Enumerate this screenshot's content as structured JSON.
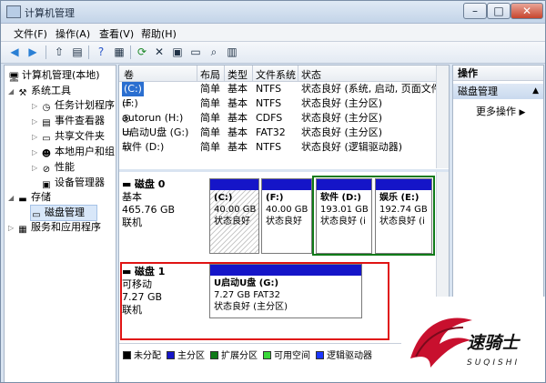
{
  "window": {
    "title": "计算机管理",
    "minimize": "–",
    "maximize": "□",
    "close": "✕"
  },
  "menu": [
    "文件(F)",
    "操作(A)",
    "查看(V)",
    "帮助(H)"
  ],
  "tree": {
    "root": "计算机管理(本地)",
    "system_tools": "系统工具",
    "task_scheduler": "任务计划程序",
    "event_viewer": "事件查看器",
    "shared_folders": "共享文件夹",
    "local_users": "本地用户和组",
    "performance": "性能",
    "device_manager": "设备管理器",
    "storage": "存储",
    "disk_management": "磁盘管理",
    "services_apps": "服务和应用程序"
  },
  "volume_table": {
    "headers": [
      "卷",
      "布局",
      "类型",
      "文件系统",
      "状态"
    ],
    "rows": [
      {
        "name": "(C:)",
        "layout": "简单",
        "type": "基本",
        "fs": "NTFS",
        "status": "状态良好 (系统, 启动, 页面文件, 活"
      },
      {
        "name": "(F:)",
        "layout": "简单",
        "type": "基本",
        "fs": "NTFS",
        "status": "状态良好 (主分区)"
      },
      {
        "name": "autorun (H:)",
        "layout": "简单",
        "type": "基本",
        "fs": "CDFS",
        "status": "状态良好 (主分区)"
      },
      {
        "name": "U启动U盘 (G:)",
        "layout": "简单",
        "type": "基本",
        "fs": "FAT32",
        "status": "状态良好 (主分区)"
      },
      {
        "name": "软件 (D:)",
        "layout": "简单",
        "type": "基本",
        "fs": "NTFS",
        "status": "状态良好 (逻辑驱动器)"
      }
    ]
  },
  "disk0": {
    "name": "磁盘 0",
    "type": "基本",
    "size": "465.76 GB",
    "state": "联机",
    "partitions": [
      {
        "name": "(C:)",
        "size": "40.00 GB",
        "status": "状态良好"
      },
      {
        "name": "(F:)",
        "size": "40.00 GB",
        "status": "状态良好"
      },
      {
        "name": "软件 (D:)",
        "size": "193.01 GB",
        "status": "状态良好 (i"
      },
      {
        "name": "娱乐 (E:)",
        "size": "192.74 GB",
        "status": "状态良好 (i"
      }
    ]
  },
  "disk1": {
    "name": "磁盘 1",
    "type": "可移动",
    "size": "7.27 GB",
    "state": "联机",
    "partition": {
      "name": "U启动U盘 (G:)",
      "size": "7.27 GB FAT32",
      "status": "状态良好 (主分区)"
    }
  },
  "legend": [
    {
      "label": "未分配",
      "color": "#000000"
    },
    {
      "label": "主分区",
      "color": "#1515c8"
    },
    {
      "label": "扩展分区",
      "color": "#0f7a18"
    },
    {
      "label": "可用空间",
      "color": "#3ad83a"
    },
    {
      "label": "逻辑驱动器",
      "color": "#1b36ff"
    }
  ],
  "actions": {
    "header": "操作",
    "section": "磁盘管理",
    "more": "更多操作"
  },
  "logo": {
    "main": "速骑士",
    "sub": "SUQISHI"
  },
  "colors": {
    "primary_bar": "#1515c8",
    "highlight_red": "#e01414",
    "extended_green": "#0f7a18"
  }
}
